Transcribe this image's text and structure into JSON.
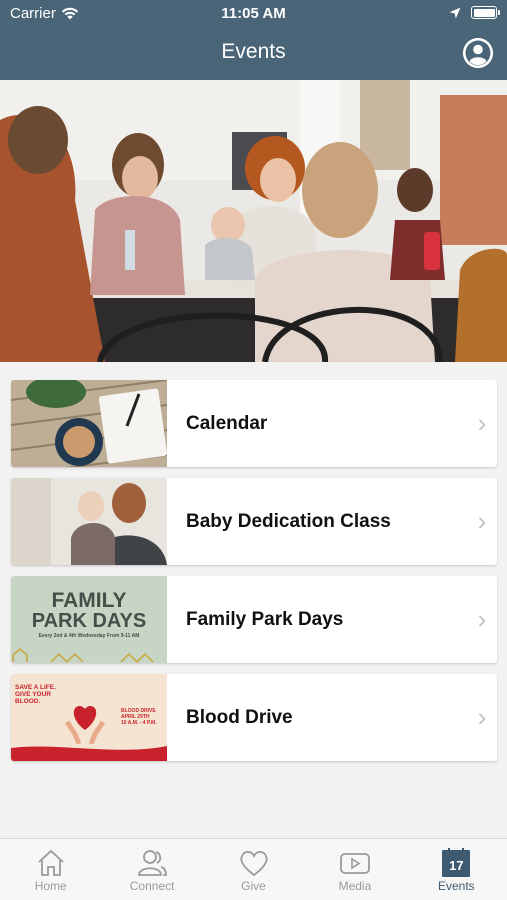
{
  "status_bar": {
    "carrier": "Carrier",
    "time": "11:05 AM"
  },
  "nav": {
    "title": "Events"
  },
  "events": [
    {
      "label": "Calendar",
      "thumb_icon": "calendar-thumbnail"
    },
    {
      "label": "Baby Dedication Class",
      "thumb_icon": "baby-dedication-thumbnail"
    },
    {
      "label": "Family Park Days",
      "thumb_icon": "family-park-days-thumbnail",
      "thumb_text": {
        "line1": "FAMILY",
        "line2": "PARK DAYS",
        "line3": "Every 2nd & 4th Wednesday From 9-11 AM"
      }
    },
    {
      "label": "Blood Drive",
      "thumb_icon": "blood-drive-thumbnail",
      "thumb_text": {
        "headline": "SAVE A LIFE. GIVE YOUR BLOOD.",
        "event": "BLOOD DRIVE",
        "date": "APRIL 29TH",
        "hours": "10 A.M. - 4 P.M."
      }
    }
  ],
  "tabs": [
    {
      "label": "Home",
      "icon": "home-icon"
    },
    {
      "label": "Connect",
      "icon": "people-icon"
    },
    {
      "label": "Give",
      "icon": "heart-icon"
    },
    {
      "label": "Media",
      "icon": "play-icon"
    },
    {
      "label": "Events",
      "icon": "calendar-icon",
      "badge": "17",
      "active": true
    }
  ],
  "colors": {
    "nav_bg": "#4a6478",
    "active_tab": "#3e5a70",
    "inactive_tab": "#9a9a9a",
    "page_bg": "#f2f2f2"
  }
}
